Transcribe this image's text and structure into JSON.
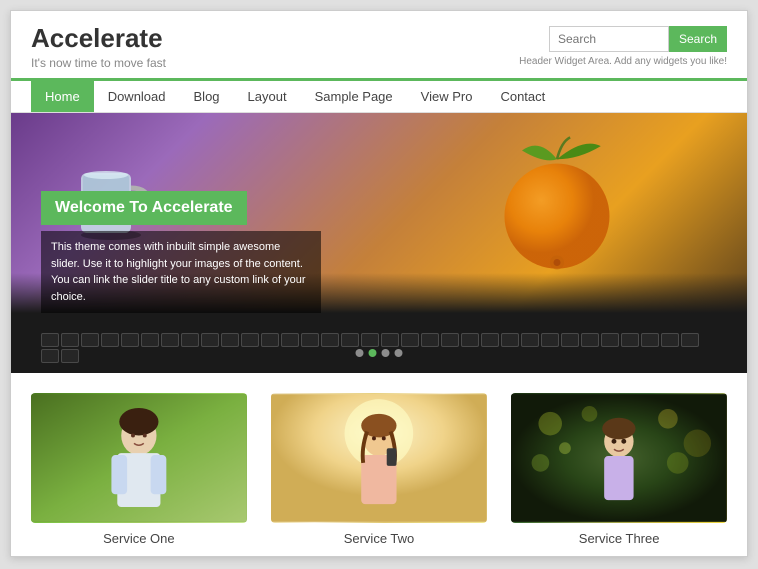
{
  "header": {
    "title": "Accelerate",
    "tagline": "It's now time to move fast",
    "search_placeholder": "Search",
    "search_button": "Search",
    "widget_text": "Header Widget Area. Add any widgets you like!"
  },
  "nav": {
    "items": [
      {
        "label": "Home",
        "active": true
      },
      {
        "label": "Download",
        "active": false
      },
      {
        "label": "Blog",
        "active": false
      },
      {
        "label": "Layout",
        "active": false
      },
      {
        "label": "Sample Page",
        "active": false
      },
      {
        "label": "View Pro",
        "active": false
      },
      {
        "label": "Contact",
        "active": false
      }
    ]
  },
  "hero": {
    "title": "Welcome To Accelerate",
    "description": "This theme comes with inbuilt simple awesome slider. Use it to highlight your images of the content. You can link the slider title to any custom link of your choice.",
    "dots": [
      1,
      2,
      3,
      4
    ]
  },
  "services": [
    {
      "label": "Service One"
    },
    {
      "label": "Service Two"
    },
    {
      "label": "Service Three"
    }
  ],
  "colors": {
    "accent": "#5cb85c",
    "text_dark": "#333",
    "text_muted": "#888"
  }
}
